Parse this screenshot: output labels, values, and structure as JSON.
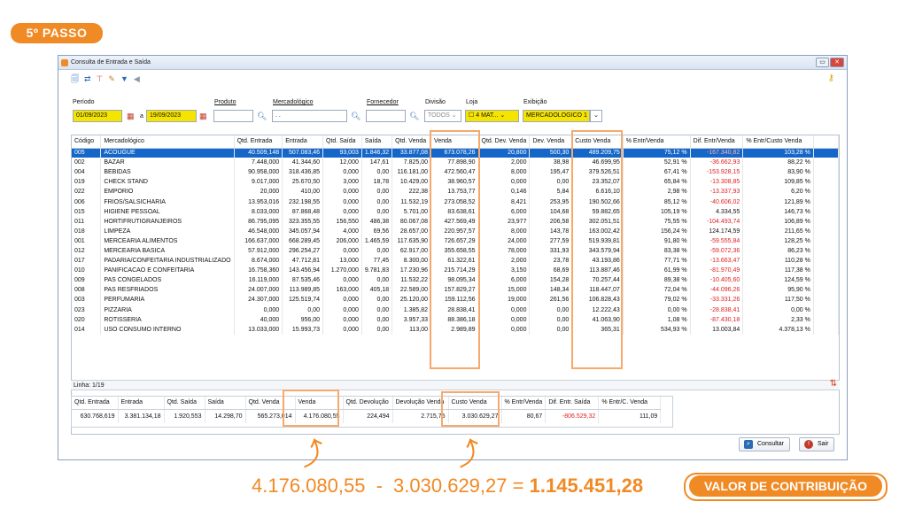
{
  "step_label": "5º PASSO",
  "window": {
    "title": "Consulta de Entrada e Saída"
  },
  "filters": {
    "periodo_label": "Período",
    "date_from": "01/09/2023",
    "a_label": "a",
    "date_to": "19/09/2023",
    "produto_label": "Produto",
    "mercadologico_label": "Mercadológico",
    "mercadologico_value": ". .",
    "fornecedor_label": "Fornecedor",
    "divisao_label": "Divisão",
    "divisao_value": "TODOS",
    "loja_label": "Loja",
    "loja_value": "4 MAT...",
    "exibicao_label": "Exibição",
    "exibicao_value": "MERCADOLOGICO 1"
  },
  "table": {
    "columns": [
      "Código",
      "Mercadológico",
      "Qtd. Entrada",
      "Entrada",
      "Qtd. Saída",
      "Saída",
      "Qtd. Venda",
      "Venda",
      "Qtd. Dev. Venda",
      "Dev. Venda",
      "Custo Venda",
      "% Entr/Venda",
      "Dif. Entr/Venda",
      "% Entr/Custo Venda"
    ],
    "rows": [
      [
        "005",
        "ACOUGUE",
        "40.509,148",
        "507.083,46",
        "93,003",
        "1.846,32",
        "33.877,08",
        "673.078,26",
        "20,800",
        "500,30",
        "489.209,75",
        "75,12 %",
        "-167.340,82",
        "103,28 %"
      ],
      [
        "002",
        "BAZAR",
        "7.448,000",
        "41.344,60",
        "12,000",
        "147,61",
        "7.825,00",
        "77.898,90",
        "2,000",
        "38,98",
        "46.699,95",
        "52,91 %",
        "-36.662,93",
        "88,22 %"
      ],
      [
        "004",
        "BEBIDAS",
        "90.958,000",
        "318.436,85",
        "0,000",
        "0,00",
        "116.181,00",
        "472.560,47",
        "8,000",
        "195,47",
        "379.526,51",
        "67,41 %",
        "-153.928,15",
        "83,90 %"
      ],
      [
        "019",
        "CHECK STAND",
        "9.017,000",
        "25.670,50",
        "3,000",
        "18,78",
        "10.429,00",
        "38.960,57",
        "0,000",
        "0,00",
        "23.352,07",
        "65,84 %",
        "-13.308,85",
        "109,85 %"
      ],
      [
        "022",
        "EMPORIO",
        "20,000",
        "410,00",
        "0,000",
        "0,00",
        "222,38",
        "13.753,77",
        "0,146",
        "5,84",
        "6.616,10",
        "2,98 %",
        "-13.337,93",
        "6,20 %"
      ],
      [
        "006",
        "FRIOS/SALSICHARIA",
        "13.953,016",
        "232.198,55",
        "0,000",
        "0,00",
        "11.532,19",
        "273.058,52",
        "8,421",
        "253,95",
        "190.502,66",
        "85,12 %",
        "-40.606,02",
        "121,89 %"
      ],
      [
        "015",
        "HIGIENE PESSOAL",
        "8.033,000",
        "87.868,48",
        "0,000",
        "0,00",
        "5.701,00",
        "83.638,61",
        "6,000",
        "104,68",
        "59.882,65",
        "105,19 %",
        "4.334,55",
        "146,73 %"
      ],
      [
        "011",
        "HORTIFRUTIGRANJEIROS",
        "86.795,095",
        "323.355,55",
        "156,550",
        "486,38",
        "80.067,08",
        "427.569,49",
        "23,977",
        "206,58",
        "302.051,51",
        "75,55 %",
        "-104.493,74",
        "106,89 %"
      ],
      [
        "018",
        "LIMPEZA",
        "46.548,000",
        "345.057,94",
        "4,000",
        "69,56",
        "28.657,00",
        "220.957,57",
        "8,000",
        "143,78",
        "163.002,42",
        "156,24 %",
        "124.174,59",
        "211,65 %"
      ],
      [
        "001",
        "MERCEARIA ALIMENTOS",
        "166.637,000",
        "668.289,45",
        "206,000",
        "1.465,59",
        "117.635,90",
        "726.657,29",
        "24,000",
        "277,59",
        "519.939,81",
        "91,80 %",
        "-59.555,84",
        "128,25 %"
      ],
      [
        "012",
        "MERCEARIA BASICA",
        "57.912,000",
        "296.254,27",
        "0,000",
        "0,00",
        "62.917,00",
        "355.658,55",
        "78,000",
        "331,93",
        "343.579,94",
        "83,38 %",
        "-59.072,36",
        "86,23 %"
      ],
      [
        "017",
        "PADARIA/CONFEITARIA INDUSTRIALIZADO",
        "8.674,000",
        "47.712,81",
        "13,000",
        "77,45",
        "8.300,00",
        "61.322,61",
        "2,000",
        "23,78",
        "43.193,86",
        "77,71 %",
        "-13.663,47",
        "110,28 %"
      ],
      [
        "010",
        "PANIFICACAO E CONFEITARIA",
        "16.758,360",
        "143.456,94",
        "1.270,000",
        "9.781,83",
        "17.230,96",
        "215.714,29",
        "3,150",
        "68,69",
        "113.887,46",
        "61,99 %",
        "-81.970,49",
        "117,38 %"
      ],
      [
        "009",
        "PAS CONGELADOS",
        "16.119,000",
        "87.535,46",
        "0,000",
        "0,00",
        "11.532,22",
        "98.095,34",
        "6,000",
        "154,28",
        "70.257,44",
        "89,38 %",
        "-10.405,60",
        "124,59 %"
      ],
      [
        "008",
        "PAS RESFRIADOS",
        "24.007,000",
        "113.989,85",
        "163,000",
        "405,18",
        "22.589,00",
        "157.829,27",
        "15,000",
        "148,34",
        "118.447,07",
        "72,04 %",
        "-44.096,26",
        "95,90 %"
      ],
      [
        "003",
        "PERFUMARIA",
        "24.307,000",
        "125.519,74",
        "0,000",
        "0,00",
        "25.120,00",
        "159.112,56",
        "19,000",
        "261,56",
        "106.828,43",
        "79,02 %",
        "-33.331,26",
        "117,50 %"
      ],
      [
        "023",
        "PIZZARIA",
        "0,000",
        "0,00",
        "0,000",
        "0,00",
        "1.385,82",
        "28.838,41",
        "0,000",
        "0,00",
        "12.222,43",
        "0,00 %",
        "-28.838,41",
        "0,00 %"
      ],
      [
        "020",
        "ROTISSERIA",
        "40,000",
        "956,00",
        "0,000",
        "0,00",
        "3.957,33",
        "88.386,18",
        "0,000",
        "0,00",
        "41.063,90",
        "1,08 %",
        "-87.430,18",
        "2,33 %"
      ],
      [
        "014",
        "USO CONSUMO INTERNO",
        "13.033,000",
        "15.993,73",
        "0,000",
        "0,00",
        "113,00",
        "2.989,89",
        "0,000",
        "0,00",
        "365,31",
        "534,93 %",
        "13.003,84",
        "4.378,13 %"
      ]
    ]
  },
  "linha_label": "Linha: 1/19",
  "totals": {
    "columns": [
      "Qtd. Entrada",
      "Entrada",
      "Qtd. Saída",
      "Saída",
      "Qtd. Venda",
      "Venda",
      "Qtd. Devolução",
      "Devolução Venda",
      "Custo Venda",
      "% Entr/Venda",
      "Dif. Entr. Saída",
      "% Entr/C. Venda"
    ],
    "values": [
      "630.768,619",
      "3.381.134,18",
      "1.920,553",
      "14.298,70",
      "565.273,014",
      "4.176.080,55",
      "224,494",
      "2.715,75",
      "3.030.629,27",
      "80,67",
      "-806.529,32",
      "111,09"
    ]
  },
  "buttons": {
    "consultar": "Consultar",
    "sair": "Sair"
  },
  "formula": {
    "a": "4.176.080,55",
    "minus": "-",
    "b": "3.030.629,27",
    "eq": "=",
    "result": "1.145.451,28"
  },
  "valor_label": "VALOR DE CONTRIBUIÇÃO",
  "colors": {
    "accent": "#f08a24",
    "selected": "#1467c8",
    "highlight": "#f5e400",
    "negative": "#e02020"
  }
}
